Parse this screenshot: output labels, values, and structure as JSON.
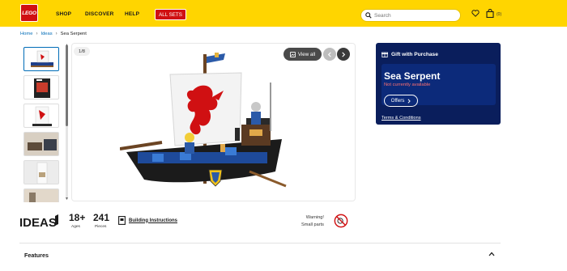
{
  "header": {
    "logo_text": "LEGO",
    "nav": [
      "SHOP",
      "DISCOVER",
      "HELP"
    ],
    "all_sets_label": "ALL SETS",
    "search_placeholder": "Search",
    "bag_count": "(0)",
    "brand_yellow": "#ffd500",
    "brand_red": "#d01012"
  },
  "breadcrumb": {
    "items": [
      "Home",
      "Ideas",
      "Sea Serpent"
    ]
  },
  "gallery": {
    "counter": "1/8",
    "view_all_label": "View all",
    "thumbnail_count": 6,
    "selected_thumbnail": 1
  },
  "purchase_panel": {
    "gift_label": "Gift with Purchase",
    "product_name": "Sea Serpent",
    "availability": "Not currently available",
    "offers_label": "Offers",
    "terms_label": "Terms & Conditions",
    "panel_color": "#0a1e5c",
    "availability_color": "#ff7070"
  },
  "product_info": {
    "theme_logo_text": "IDEAS",
    "age_value": "18+",
    "age_label": "Ages",
    "pieces_value": "241",
    "pieces_label": "Pieces",
    "instructions_label": "Building Instructions",
    "warning_line1": "Warning!",
    "warning_line2": "Small parts"
  },
  "sections": {
    "features_label": "Features"
  }
}
